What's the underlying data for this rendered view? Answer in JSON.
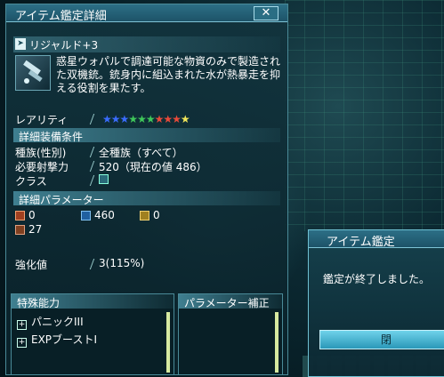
{
  "window": {
    "title": "アイテム鑑定詳細",
    "close_glyph": "✕"
  },
  "item": {
    "name": "リジャルド+3",
    "description": "惑星ウォパルで調達可能な物資のみで製造された双機銃。銃身内に組込まれた水が熱暴走を抑える役割を果たす。",
    "rarity_label": "レアリティ",
    "stars": [
      {
        "glyph": "★",
        "color": "#3a6cff"
      },
      {
        "glyph": "★",
        "color": "#3a6cff"
      },
      {
        "glyph": "★",
        "color": "#3a6cff"
      },
      {
        "glyph": "★",
        "color": "#3fc85a"
      },
      {
        "glyph": "★",
        "color": "#3fc85a"
      },
      {
        "glyph": "★",
        "color": "#3fc85a"
      },
      {
        "glyph": "★",
        "color": "#e84a3a"
      },
      {
        "glyph": "★",
        "color": "#e84a3a"
      },
      {
        "glyph": "★",
        "color": "#e84a3a"
      },
      {
        "glyph": "★",
        "color": "#f2e65a"
      }
    ]
  },
  "equip": {
    "section": "詳細装備条件",
    "race_label": "種族(性別)",
    "race_value": "全種族（すべて）",
    "shoot_label": "必要射撃力",
    "shoot_value": "520（現在の値 486）",
    "class_label": "クラス"
  },
  "params": {
    "section": "詳細パラメーター",
    "melee": "0",
    "ranged": "460",
    "tech": "0",
    "dex": "27",
    "grind_label": "強化値",
    "grind_value": "3(115%)"
  },
  "abilities": {
    "section": "特殊能力",
    "items": [
      "パニックIII",
      "EXPブーストI"
    ]
  },
  "param_bonus": {
    "section": "パラメーター補正"
  },
  "dialog": {
    "title": "アイテム鑑定",
    "message": "鑑定が終了しました。",
    "ok_label": "閉"
  },
  "colors": {
    "accent": "#2c6f86",
    "panel": "#12343e"
  }
}
